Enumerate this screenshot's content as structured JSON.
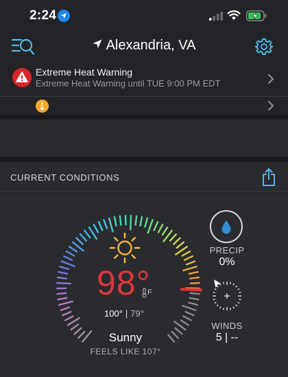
{
  "status_bar": {
    "time": "2:24"
  },
  "header": {
    "city": "Alexandria, VA"
  },
  "alerts": [
    {
      "title": "Extreme Heat Warning",
      "detail": "Extreme Heat Warning until TUE 9:00 PM EDT",
      "color": "#d9262a"
    },
    {
      "icon": "thermometer-icon",
      "color": "#f4a62a"
    }
  ],
  "current_conditions": {
    "title": "CURRENT CONDITIONS",
    "temperature": "98°",
    "unit": "F",
    "high": "100°",
    "low": "79°",
    "separator": "|",
    "condition": "Sunny",
    "feels_like": "FEELS LIKE 107°",
    "temp_color": "#d8373d",
    "precip": {
      "label": "PRECIP",
      "value": "0%"
    },
    "winds": {
      "label": "WINDS",
      "value": "5 | --"
    }
  }
}
